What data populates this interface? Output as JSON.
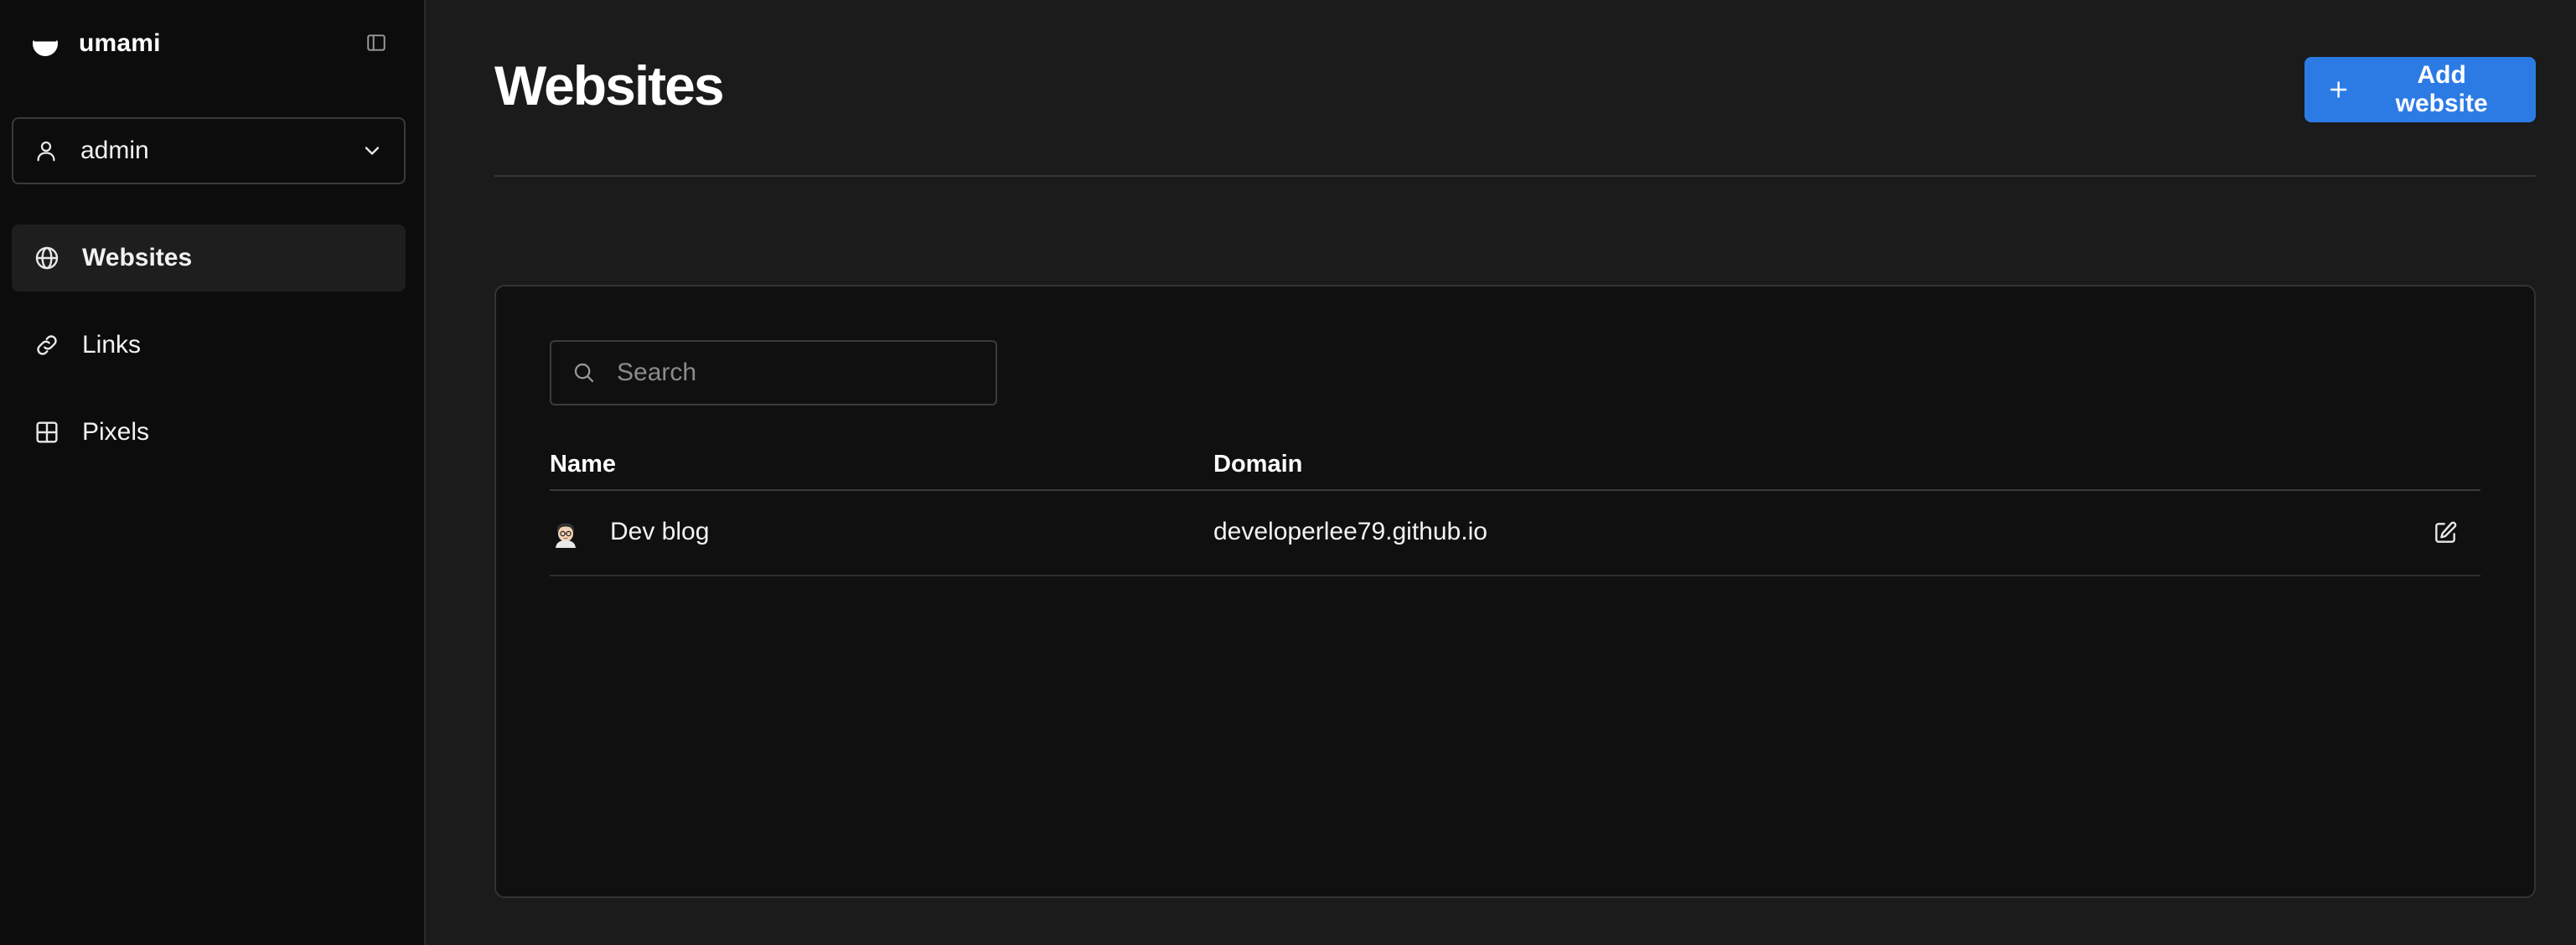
{
  "app": {
    "name": "umami"
  },
  "account": {
    "name": "admin"
  },
  "nav": {
    "items": [
      {
        "label": "Websites",
        "icon": "globe-icon",
        "active": true
      },
      {
        "label": "Links",
        "icon": "link-icon",
        "active": false
      },
      {
        "label": "Pixels",
        "icon": "grid-icon",
        "active": false
      }
    ]
  },
  "page": {
    "title": "Websites",
    "add_button_label": "Add website"
  },
  "search": {
    "placeholder": "Search",
    "value": ""
  },
  "table": {
    "columns": [
      "Name",
      "Domain"
    ],
    "rows": [
      {
        "name": "Dev blog",
        "domain": "developerlee79.github.io"
      }
    ]
  },
  "colors": {
    "accent": "#2c7be5",
    "sidebar_bg": "#0c0c0c",
    "main_bg": "#1b1b1b",
    "card_bg": "#101010"
  }
}
